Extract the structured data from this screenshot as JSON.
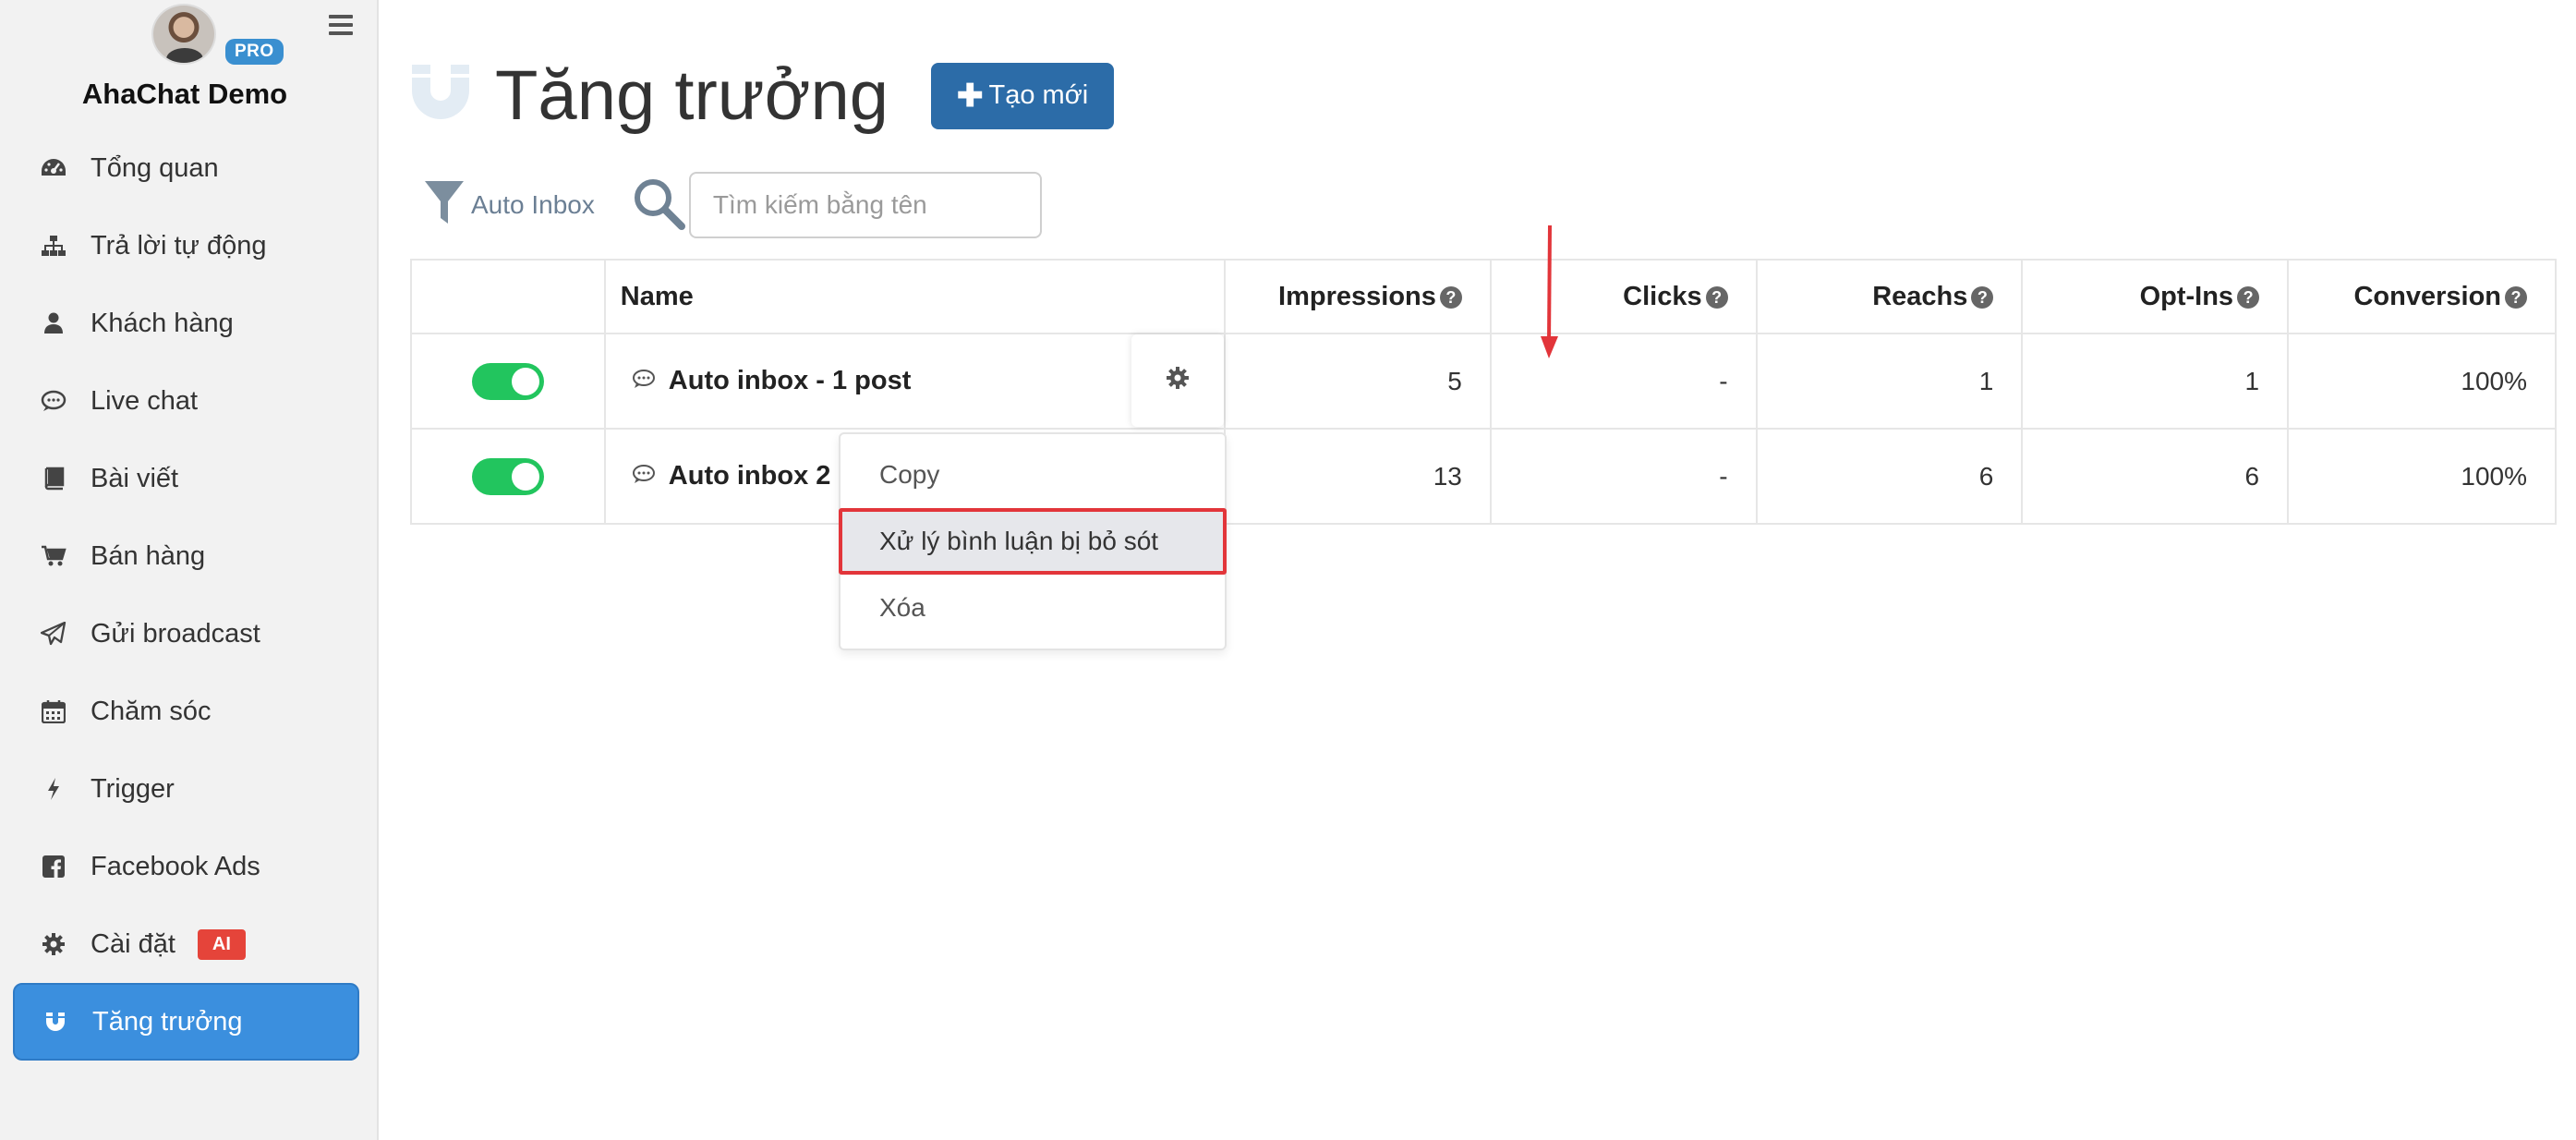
{
  "sidebar": {
    "pro_label": "PRO",
    "app_name": "AhaChat Demo",
    "items": [
      {
        "label": "Tổng quan",
        "icon": "dashboard-icon"
      },
      {
        "label": "Trả lời tự động",
        "icon": "sitemap-icon"
      },
      {
        "label": "Khách hàng",
        "icon": "user-icon"
      },
      {
        "label": "Live chat",
        "icon": "chat-icon"
      },
      {
        "label": "Bài viết",
        "icon": "book-icon"
      },
      {
        "label": "Bán hàng",
        "icon": "cart-icon"
      },
      {
        "label": "Gửi broadcast",
        "icon": "paper-plane-icon"
      },
      {
        "label": "Chăm sóc",
        "icon": "calendar-icon"
      },
      {
        "label": "Trigger",
        "icon": "bolt-icon"
      },
      {
        "label": "Facebook Ads",
        "icon": "facebook-icon"
      },
      {
        "label": "Cài đặt",
        "icon": "gear-icon",
        "badge": "AI"
      },
      {
        "label": "Tăng trưởng",
        "icon": "magnet-icon",
        "active": true
      }
    ]
  },
  "header": {
    "title": "Tăng trưởng",
    "create_button": "Tạo mới"
  },
  "filter": {
    "label": "Auto Inbox",
    "search_placeholder": "Tìm kiếm bằng tên"
  },
  "table": {
    "columns": [
      "",
      "Name",
      "Impressions",
      "Clicks",
      "Reachs",
      "Opt-Ins",
      "Conversion"
    ],
    "rows": [
      {
        "enabled": true,
        "name": "Auto inbox - 1 post",
        "impressions": "5",
        "clicks": "-",
        "reachs": "1",
        "optins": "1",
        "conversion": "100%"
      },
      {
        "enabled": true,
        "name": "Auto inbox 2",
        "impressions": "13",
        "clicks": "-",
        "reachs": "6",
        "optins": "6",
        "conversion": "100%"
      }
    ]
  },
  "dropdown": {
    "items": [
      "Copy",
      "Xử lý bình luận bị bỏ sót",
      "Xóa"
    ],
    "highlighted_index": 1
  },
  "colors": {
    "accent": "#3b8fde",
    "primary_button": "#2c6ca8",
    "toggle_on": "#22c55e",
    "highlight_border": "#e2353a",
    "ai_badge": "#e5443a"
  }
}
